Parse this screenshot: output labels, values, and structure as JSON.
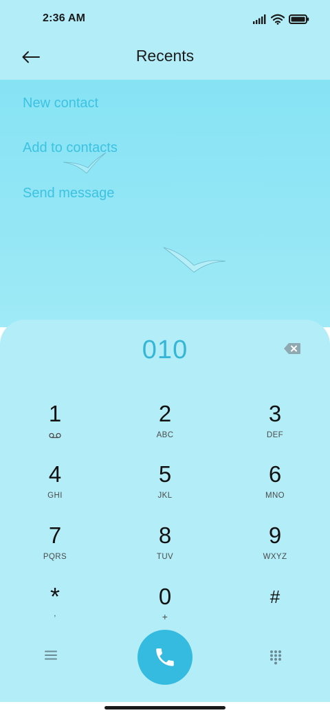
{
  "status_bar": {
    "time": "2:36 AM",
    "icons": [
      "signal-icon",
      "wifi-icon",
      "battery-icon"
    ]
  },
  "header": {
    "back_icon": "arrow-left-icon",
    "title": "Recents"
  },
  "actions": {
    "new_contact": "New contact",
    "add_to_contacts": "Add to contacts",
    "send_message": "Send message"
  },
  "dialer": {
    "number": "010",
    "backspace_icon": "backspace-icon"
  },
  "keys": [
    {
      "digit": "1",
      "sub": ""
    },
    {
      "digit": "2",
      "sub": "ABC"
    },
    {
      "digit": "3",
      "sub": "DEF"
    },
    {
      "digit": "4",
      "sub": "GHI"
    },
    {
      "digit": "5",
      "sub": "JKL"
    },
    {
      "digit": "6",
      "sub": "MNO"
    },
    {
      "digit": "7",
      "sub": "PQRS"
    },
    {
      "digit": "8",
      "sub": "TUV"
    },
    {
      "digit": "9",
      "sub": "WXYZ"
    },
    {
      "digit": "*",
      "sub": ","
    },
    {
      "digit": "0",
      "sub": "+"
    },
    {
      "digit": "#",
      "sub": ""
    }
  ],
  "bottom_bar": {
    "menu_icon": "menu-icon",
    "call_icon": "phone-icon",
    "dialpad_icon": "dialpad-icon"
  },
  "colors": {
    "accent": "#35bbe0",
    "panel": "#b3eef8",
    "link": "#3cc2e2"
  }
}
